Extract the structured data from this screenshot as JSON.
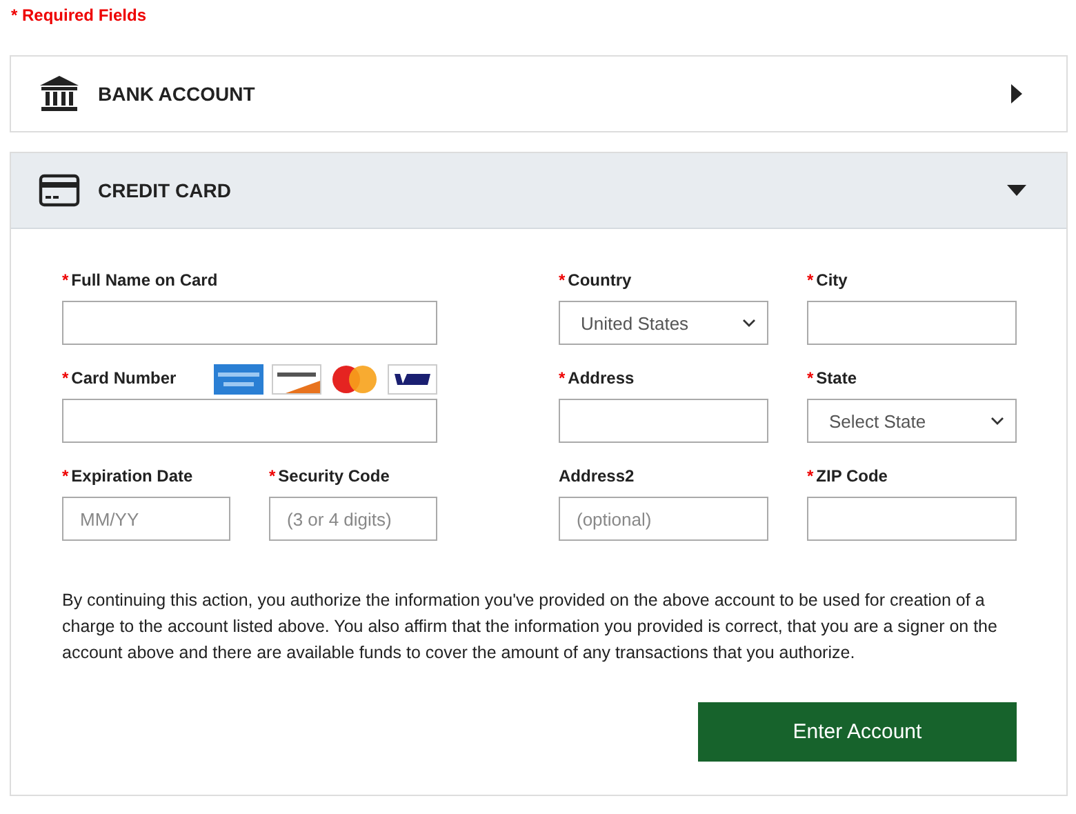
{
  "required_note": "* Required Fields",
  "sections": [
    {
      "label": "BANK ACCOUNT",
      "kind": "bank",
      "expanded": false
    },
    {
      "label": "CREDIT CARD",
      "kind": "card",
      "expanded": true
    }
  ],
  "payment_fields": [
    {
      "label": "Full Name on Card",
      "required": true,
      "kind": "input",
      "card_logos": false
    },
    {
      "label": "Card Number",
      "required": true,
      "kind": "input",
      "card_logos": true
    },
    {
      "label": "Expiration Date",
      "required": true,
      "kind": "input",
      "placeholder": "MM/YY",
      "card_logos": false
    },
    {
      "label": "Security Code",
      "required": true,
      "kind": "input",
      "placeholder": "(3 or 4 digits)",
      "card_logos": false
    }
  ],
  "address_fields": [
    {
      "label": "Country",
      "required": true,
      "kind": "select",
      "value": "United States"
    },
    {
      "label": "City",
      "required": true,
      "kind": "input"
    },
    {
      "label": "Address",
      "required": true,
      "kind": "input"
    },
    {
      "label": "State",
      "required": true,
      "kind": "select",
      "value": "Select State"
    },
    {
      "label": "Address2",
      "required": false,
      "kind": "input",
      "placeholder": "(optional)"
    },
    {
      "label": "ZIP Code",
      "required": true,
      "kind": "input"
    }
  ],
  "required_mark": "*",
  "disclaimer": "By continuing this action, you authorize the information you've provided on the above account to be used for creation of a charge to the account listed above. You also affirm that the information you provided is correct, that you are a signer on the account above and there are available funds to cover the amount of any transactions that you authorize.",
  "submit_button": "Enter Account"
}
